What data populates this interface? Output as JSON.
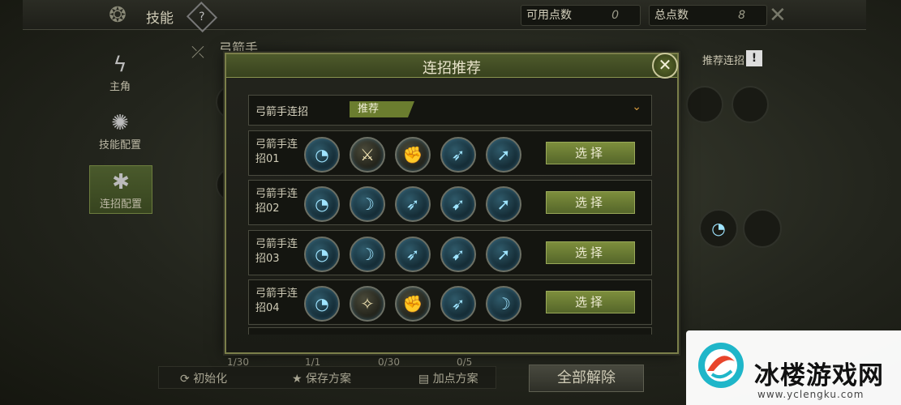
{
  "topbar": {
    "title": "技能",
    "help_icon": "?",
    "available_points_label": "可用点数",
    "available_points_value": "0",
    "total_points_label": "总点数",
    "total_points_value": "8"
  },
  "sidebar": {
    "items": [
      {
        "label": "主角",
        "icon": "lightning-icon"
      },
      {
        "label": "技能配置",
        "icon": "swirl-icon"
      },
      {
        "label": "连招配置",
        "icon": "combo-icon",
        "active": true
      }
    ]
  },
  "background": {
    "class_name": "弓箭手",
    "recommend_label": "推荐连招",
    "recommend_badge": "!",
    "counts": [
      "1/30",
      "1/1",
      "0/30",
      "0/5"
    ],
    "bottom_buttons": [
      "初始化",
      "保存方案",
      "加点方案"
    ],
    "release_all": "全部解除"
  },
  "modal": {
    "title": "连招推荐",
    "close_symbol": "✕",
    "dropdown": {
      "label": "弓箭手连招",
      "tag": "推荐",
      "chevron": "⌄"
    },
    "rows": [
      {
        "name": "弓箭手连招01",
        "button": "选择",
        "skills": [
          "whirl",
          "crossed-swords",
          "fist",
          "arrow-shot",
          "arrow-pierce"
        ]
      },
      {
        "name": "弓箭手连招02",
        "button": "选择",
        "skills": [
          "whirl",
          "bow-draw",
          "arrow-shot",
          "arrow-volley",
          "arrow-pierce"
        ]
      },
      {
        "name": "弓箭手连招03",
        "button": "选择",
        "skills": [
          "whirl",
          "bow-draw",
          "arrow-shot",
          "arrow-volley",
          "arrow-pierce"
        ]
      },
      {
        "name": "弓箭手连招04",
        "button": "选择",
        "skills": [
          "whirl",
          "leap",
          "fist",
          "arrow-shot",
          "bow-draw"
        ]
      }
    ]
  },
  "watermark": {
    "text": "冰楼游戏网",
    "url": "www.yclengku.com"
  },
  "colors": {
    "accent_green": "#6b7d2f",
    "chevron_orange": "#d79a3d",
    "skill_glow": "#9fe4ff"
  }
}
